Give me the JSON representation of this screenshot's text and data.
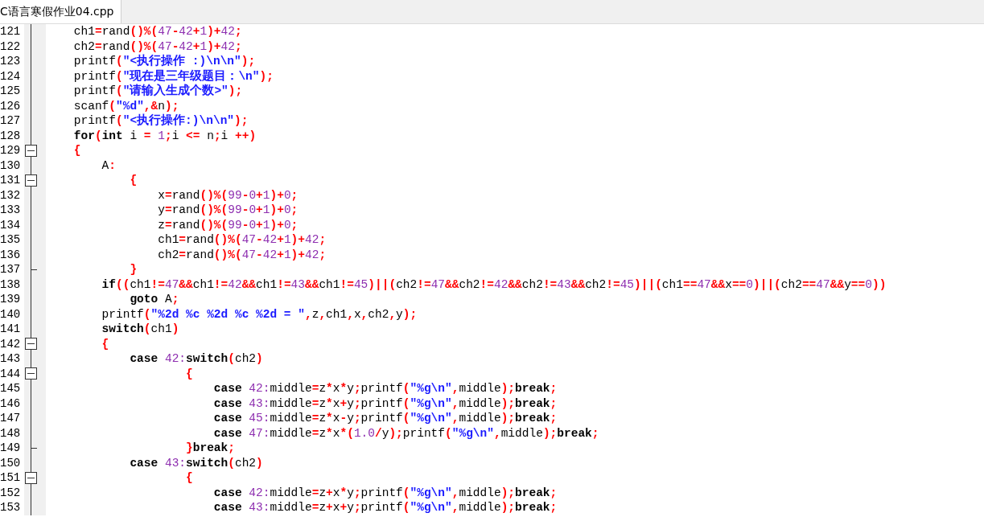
{
  "tabs": [
    {
      "label": "C语言寒假作业04.cpp",
      "selected": true
    }
  ],
  "editor": {
    "lines": [
      {
        "number": "121",
        "kind": "plain",
        "tokens": [
          {
            "kind": "plain",
            "text": "    ch1"
          },
          {
            "kind": "op",
            "text": "="
          },
          {
            "kind": "plain",
            "text": "rand"
          },
          {
            "kind": "op",
            "text": "()%("
          },
          {
            "kind": "num",
            "text": "47"
          },
          {
            "kind": "op",
            "text": "-"
          },
          {
            "kind": "num",
            "text": "42"
          },
          {
            "kind": "op",
            "text": "+"
          },
          {
            "kind": "num",
            "text": "1"
          },
          {
            "kind": "op",
            "text": ")+"
          },
          {
            "kind": "num",
            "text": "42"
          },
          {
            "kind": "op",
            "text": ";"
          }
        ]
      },
      {
        "number": "122",
        "kind": "plain",
        "tokens": [
          {
            "kind": "plain",
            "text": "    ch2"
          },
          {
            "kind": "op",
            "text": "="
          },
          {
            "kind": "plain",
            "text": "rand"
          },
          {
            "kind": "op",
            "text": "()%("
          },
          {
            "kind": "num",
            "text": "47"
          },
          {
            "kind": "op",
            "text": "-"
          },
          {
            "kind": "num",
            "text": "42"
          },
          {
            "kind": "op",
            "text": "+"
          },
          {
            "kind": "num",
            "text": "1"
          },
          {
            "kind": "op",
            "text": ")+"
          },
          {
            "kind": "num",
            "text": "42"
          },
          {
            "kind": "op",
            "text": ";"
          }
        ]
      },
      {
        "number": "123",
        "kind": "plain",
        "tokens": [
          {
            "kind": "plain",
            "text": "    printf"
          },
          {
            "kind": "op",
            "text": "("
          },
          {
            "kind": "str",
            "text": "\"<执行操作 :)\\n\\n\""
          },
          {
            "kind": "op",
            "text": ");"
          }
        ]
      },
      {
        "number": "124",
        "kind": "plain",
        "tokens": [
          {
            "kind": "plain",
            "text": "    printf"
          },
          {
            "kind": "op",
            "text": "("
          },
          {
            "kind": "str",
            "text": "\"现在是三年级题目：\\n\""
          },
          {
            "kind": "op",
            "text": ");"
          }
        ]
      },
      {
        "number": "125",
        "kind": "plain",
        "tokens": [
          {
            "kind": "plain",
            "text": "    printf"
          },
          {
            "kind": "op",
            "text": "("
          },
          {
            "kind": "str",
            "text": "\"请输入生成个数>\""
          },
          {
            "kind": "op",
            "text": ");"
          }
        ]
      },
      {
        "number": "126",
        "kind": "plain",
        "tokens": [
          {
            "kind": "plain",
            "text": "    scanf"
          },
          {
            "kind": "op",
            "text": "("
          },
          {
            "kind": "str",
            "text": "\"%d\""
          },
          {
            "kind": "op",
            "text": ",&"
          },
          {
            "kind": "plain",
            "text": "n"
          },
          {
            "kind": "op",
            "text": ");"
          }
        ]
      },
      {
        "number": "127",
        "kind": "plain",
        "tokens": [
          {
            "kind": "plain",
            "text": "    printf"
          },
          {
            "kind": "op",
            "text": "("
          },
          {
            "kind": "str",
            "text": "\"<执行操作:)\\n\\n\""
          },
          {
            "kind": "op",
            "text": ");"
          }
        ]
      },
      {
        "number": "128",
        "kind": "plain",
        "tokens": [
          {
            "kind": "kw",
            "text": "    for"
          },
          {
            "kind": "op",
            "text": "("
          },
          {
            "kind": "kw",
            "text": "int"
          },
          {
            "kind": "plain",
            "text": " i "
          },
          {
            "kind": "op",
            "text": "= "
          },
          {
            "kind": "num",
            "text": "1"
          },
          {
            "kind": "op",
            "text": ";"
          },
          {
            "kind": "plain",
            "text": "i "
          },
          {
            "kind": "op",
            "text": "<="
          },
          {
            "kind": "plain",
            "text": " n"
          },
          {
            "kind": "op",
            "text": ";"
          },
          {
            "kind": "plain",
            "text": "i "
          },
          {
            "kind": "op",
            "text": "++)"
          }
        ]
      },
      {
        "number": "129",
        "kind": "open",
        "tokens": [
          {
            "kind": "op",
            "text": "    {"
          }
        ]
      },
      {
        "number": "130",
        "kind": "plain",
        "tokens": [
          {
            "kind": "plain",
            "text": "        A"
          },
          {
            "kind": "op",
            "text": ":"
          }
        ]
      },
      {
        "number": "131",
        "kind": "open",
        "tokens": [
          {
            "kind": "op",
            "text": "            {"
          }
        ]
      },
      {
        "number": "132",
        "kind": "plain",
        "tokens": [
          {
            "kind": "plain",
            "text": "                x"
          },
          {
            "kind": "op",
            "text": "="
          },
          {
            "kind": "plain",
            "text": "rand"
          },
          {
            "kind": "op",
            "text": "()%("
          },
          {
            "kind": "num",
            "text": "99"
          },
          {
            "kind": "op",
            "text": "-"
          },
          {
            "kind": "num",
            "text": "0"
          },
          {
            "kind": "op",
            "text": "+"
          },
          {
            "kind": "num",
            "text": "1"
          },
          {
            "kind": "op",
            "text": ")+"
          },
          {
            "kind": "num",
            "text": "0"
          },
          {
            "kind": "op",
            "text": ";"
          }
        ]
      },
      {
        "number": "133",
        "kind": "plain",
        "tokens": [
          {
            "kind": "plain",
            "text": "                y"
          },
          {
            "kind": "op",
            "text": "="
          },
          {
            "kind": "plain",
            "text": "rand"
          },
          {
            "kind": "op",
            "text": "()%("
          },
          {
            "kind": "num",
            "text": "99"
          },
          {
            "kind": "op",
            "text": "-"
          },
          {
            "kind": "num",
            "text": "0"
          },
          {
            "kind": "op",
            "text": "+"
          },
          {
            "kind": "num",
            "text": "1"
          },
          {
            "kind": "op",
            "text": ")+"
          },
          {
            "kind": "num",
            "text": "0"
          },
          {
            "kind": "op",
            "text": ";"
          }
        ]
      },
      {
        "number": "134",
        "kind": "plain",
        "tokens": [
          {
            "kind": "plain",
            "text": "                z"
          },
          {
            "kind": "op",
            "text": "="
          },
          {
            "kind": "plain",
            "text": "rand"
          },
          {
            "kind": "op",
            "text": "()%("
          },
          {
            "kind": "num",
            "text": "99"
          },
          {
            "kind": "op",
            "text": "-"
          },
          {
            "kind": "num",
            "text": "0"
          },
          {
            "kind": "op",
            "text": "+"
          },
          {
            "kind": "num",
            "text": "1"
          },
          {
            "kind": "op",
            "text": ")+"
          },
          {
            "kind": "num",
            "text": "0"
          },
          {
            "kind": "op",
            "text": ";"
          }
        ]
      },
      {
        "number": "135",
        "kind": "plain",
        "tokens": [
          {
            "kind": "plain",
            "text": "                ch1"
          },
          {
            "kind": "op",
            "text": "="
          },
          {
            "kind": "plain",
            "text": "rand"
          },
          {
            "kind": "op",
            "text": "()%("
          },
          {
            "kind": "num",
            "text": "47"
          },
          {
            "kind": "op",
            "text": "-"
          },
          {
            "kind": "num",
            "text": "42"
          },
          {
            "kind": "op",
            "text": "+"
          },
          {
            "kind": "num",
            "text": "1"
          },
          {
            "kind": "op",
            "text": ")+"
          },
          {
            "kind": "num",
            "text": "42"
          },
          {
            "kind": "op",
            "text": ";"
          }
        ]
      },
      {
        "number": "136",
        "kind": "plain",
        "tokens": [
          {
            "kind": "plain",
            "text": "                ch2"
          },
          {
            "kind": "op",
            "text": "="
          },
          {
            "kind": "plain",
            "text": "rand"
          },
          {
            "kind": "op",
            "text": "()%("
          },
          {
            "kind": "num",
            "text": "47"
          },
          {
            "kind": "op",
            "text": "-"
          },
          {
            "kind": "num",
            "text": "42"
          },
          {
            "kind": "op",
            "text": "+"
          },
          {
            "kind": "num",
            "text": "1"
          },
          {
            "kind": "op",
            "text": ")+"
          },
          {
            "kind": "num",
            "text": "42"
          },
          {
            "kind": "op",
            "text": ";"
          }
        ]
      },
      {
        "number": "137",
        "kind": "end",
        "tokens": [
          {
            "kind": "op",
            "text": "            }"
          }
        ]
      },
      {
        "number": "138",
        "kind": "plain",
        "tokens": [
          {
            "kind": "kw",
            "text": "        if"
          },
          {
            "kind": "op",
            "text": "(("
          },
          {
            "kind": "plain",
            "text": "ch1"
          },
          {
            "kind": "op",
            "text": "!="
          },
          {
            "kind": "num",
            "text": "47"
          },
          {
            "kind": "op",
            "text": "&&"
          },
          {
            "kind": "plain",
            "text": "ch1"
          },
          {
            "kind": "op",
            "text": "!="
          },
          {
            "kind": "num",
            "text": "42"
          },
          {
            "kind": "op",
            "text": "&&"
          },
          {
            "kind": "plain",
            "text": "ch1"
          },
          {
            "kind": "op",
            "text": "!="
          },
          {
            "kind": "num",
            "text": "43"
          },
          {
            "kind": "op",
            "text": "&&"
          },
          {
            "kind": "plain",
            "text": "ch1"
          },
          {
            "kind": "op",
            "text": "!="
          },
          {
            "kind": "num",
            "text": "45"
          },
          {
            "kind": "op",
            "text": ")||("
          },
          {
            "kind": "plain",
            "text": "ch2"
          },
          {
            "kind": "op",
            "text": "!="
          },
          {
            "kind": "num",
            "text": "47"
          },
          {
            "kind": "op",
            "text": "&&"
          },
          {
            "kind": "plain",
            "text": "ch2"
          },
          {
            "kind": "op",
            "text": "!="
          },
          {
            "kind": "num",
            "text": "42"
          },
          {
            "kind": "op",
            "text": "&&"
          },
          {
            "kind": "plain",
            "text": "ch2"
          },
          {
            "kind": "op",
            "text": "!="
          },
          {
            "kind": "num",
            "text": "43"
          },
          {
            "kind": "op",
            "text": "&&"
          },
          {
            "kind": "plain",
            "text": "ch2"
          },
          {
            "kind": "op",
            "text": "!="
          },
          {
            "kind": "num",
            "text": "45"
          },
          {
            "kind": "op",
            "text": ")||("
          },
          {
            "kind": "plain",
            "text": "ch1"
          },
          {
            "kind": "op",
            "text": "=="
          },
          {
            "kind": "num",
            "text": "47"
          },
          {
            "kind": "op",
            "text": "&&"
          },
          {
            "kind": "plain",
            "text": "x"
          },
          {
            "kind": "op",
            "text": "=="
          },
          {
            "kind": "num",
            "text": "0"
          },
          {
            "kind": "op",
            "text": ")||("
          },
          {
            "kind": "plain",
            "text": "ch2"
          },
          {
            "kind": "op",
            "text": "=="
          },
          {
            "kind": "num",
            "text": "47"
          },
          {
            "kind": "op",
            "text": "&&"
          },
          {
            "kind": "plain",
            "text": "y"
          },
          {
            "kind": "op",
            "text": "=="
          },
          {
            "kind": "num",
            "text": "0"
          },
          {
            "kind": "op",
            "text": "))"
          }
        ]
      },
      {
        "number": "139",
        "kind": "plain",
        "tokens": [
          {
            "kind": "kw",
            "text": "            goto"
          },
          {
            "kind": "plain",
            "text": " A"
          },
          {
            "kind": "op",
            "text": ";"
          }
        ]
      },
      {
        "number": "140",
        "kind": "plain",
        "tokens": [
          {
            "kind": "plain",
            "text": "        printf"
          },
          {
            "kind": "op",
            "text": "("
          },
          {
            "kind": "str",
            "text": "\"%2d %c %2d %c %2d = \""
          },
          {
            "kind": "op",
            "text": ","
          },
          {
            "kind": "plain",
            "text": "z"
          },
          {
            "kind": "op",
            "text": ","
          },
          {
            "kind": "plain",
            "text": "ch1"
          },
          {
            "kind": "op",
            "text": ","
          },
          {
            "kind": "plain",
            "text": "x"
          },
          {
            "kind": "op",
            "text": ","
          },
          {
            "kind": "plain",
            "text": "ch2"
          },
          {
            "kind": "op",
            "text": ","
          },
          {
            "kind": "plain",
            "text": "y"
          },
          {
            "kind": "op",
            "text": ");"
          }
        ]
      },
      {
        "number": "141",
        "kind": "plain",
        "tokens": [
          {
            "kind": "kw",
            "text": "        switch"
          },
          {
            "kind": "op",
            "text": "("
          },
          {
            "kind": "plain",
            "text": "ch1"
          },
          {
            "kind": "op",
            "text": ")"
          }
        ]
      },
      {
        "number": "142",
        "kind": "open",
        "tokens": [
          {
            "kind": "op",
            "text": "        {"
          }
        ]
      },
      {
        "number": "143",
        "kind": "plain",
        "tokens": [
          {
            "kind": "kw",
            "text": "            case "
          },
          {
            "kind": "num",
            "text": "42:"
          },
          {
            "kind": "kw",
            "text": "switch"
          },
          {
            "kind": "op",
            "text": "("
          },
          {
            "kind": "plain",
            "text": "ch2"
          },
          {
            "kind": "op",
            "text": ")"
          }
        ]
      },
      {
        "number": "144",
        "kind": "open",
        "tokens": [
          {
            "kind": "op",
            "text": "                    {"
          }
        ]
      },
      {
        "number": "145",
        "kind": "plain",
        "tokens": [
          {
            "kind": "kw",
            "text": "                        case "
          },
          {
            "kind": "num",
            "text": "42:"
          },
          {
            "kind": "plain",
            "text": "middle"
          },
          {
            "kind": "op",
            "text": "="
          },
          {
            "kind": "plain",
            "text": "z"
          },
          {
            "kind": "op",
            "text": "*"
          },
          {
            "kind": "plain",
            "text": "x"
          },
          {
            "kind": "op",
            "text": "*"
          },
          {
            "kind": "plain",
            "text": "y"
          },
          {
            "kind": "op",
            "text": ";"
          },
          {
            "kind": "plain",
            "text": "printf"
          },
          {
            "kind": "op",
            "text": "("
          },
          {
            "kind": "str",
            "text": "\"%g\\n\""
          },
          {
            "kind": "op",
            "text": ","
          },
          {
            "kind": "plain",
            "text": "middle"
          },
          {
            "kind": "op",
            "text": ");"
          },
          {
            "kind": "kw",
            "text": "break"
          },
          {
            "kind": "op",
            "text": ";"
          }
        ]
      },
      {
        "number": "146",
        "kind": "plain",
        "tokens": [
          {
            "kind": "kw",
            "text": "                        case "
          },
          {
            "kind": "num",
            "text": "43:"
          },
          {
            "kind": "plain",
            "text": "middle"
          },
          {
            "kind": "op",
            "text": "="
          },
          {
            "kind": "plain",
            "text": "z"
          },
          {
            "kind": "op",
            "text": "*"
          },
          {
            "kind": "plain",
            "text": "x"
          },
          {
            "kind": "op",
            "text": "+"
          },
          {
            "kind": "plain",
            "text": "y"
          },
          {
            "kind": "op",
            "text": ";"
          },
          {
            "kind": "plain",
            "text": "printf"
          },
          {
            "kind": "op",
            "text": "("
          },
          {
            "kind": "str",
            "text": "\"%g\\n\""
          },
          {
            "kind": "op",
            "text": ","
          },
          {
            "kind": "plain",
            "text": "middle"
          },
          {
            "kind": "op",
            "text": ");"
          },
          {
            "kind": "kw",
            "text": "break"
          },
          {
            "kind": "op",
            "text": ";"
          }
        ]
      },
      {
        "number": "147",
        "kind": "plain",
        "tokens": [
          {
            "kind": "kw",
            "text": "                        case "
          },
          {
            "kind": "num",
            "text": "45:"
          },
          {
            "kind": "plain",
            "text": "middle"
          },
          {
            "kind": "op",
            "text": "="
          },
          {
            "kind": "plain",
            "text": "z"
          },
          {
            "kind": "op",
            "text": "*"
          },
          {
            "kind": "plain",
            "text": "x"
          },
          {
            "kind": "op",
            "text": "-"
          },
          {
            "kind": "plain",
            "text": "y"
          },
          {
            "kind": "op",
            "text": ";"
          },
          {
            "kind": "plain",
            "text": "printf"
          },
          {
            "kind": "op",
            "text": "("
          },
          {
            "kind": "str",
            "text": "\"%g\\n\""
          },
          {
            "kind": "op",
            "text": ","
          },
          {
            "kind": "plain",
            "text": "middle"
          },
          {
            "kind": "op",
            "text": ");"
          },
          {
            "kind": "kw",
            "text": "break"
          },
          {
            "kind": "op",
            "text": ";"
          }
        ]
      },
      {
        "number": "148",
        "kind": "plain",
        "tokens": [
          {
            "kind": "kw",
            "text": "                        case "
          },
          {
            "kind": "num",
            "text": "47:"
          },
          {
            "kind": "plain",
            "text": "middle"
          },
          {
            "kind": "op",
            "text": "="
          },
          {
            "kind": "plain",
            "text": "z"
          },
          {
            "kind": "op",
            "text": "*"
          },
          {
            "kind": "plain",
            "text": "x"
          },
          {
            "kind": "op",
            "text": "*("
          },
          {
            "kind": "num",
            "text": "1.0"
          },
          {
            "kind": "op",
            "text": "/"
          },
          {
            "kind": "plain",
            "text": "y"
          },
          {
            "kind": "op",
            "text": ");"
          },
          {
            "kind": "plain",
            "text": "printf"
          },
          {
            "kind": "op",
            "text": "("
          },
          {
            "kind": "str",
            "text": "\"%g\\n\""
          },
          {
            "kind": "op",
            "text": ","
          },
          {
            "kind": "plain",
            "text": "middle"
          },
          {
            "kind": "op",
            "text": ");"
          },
          {
            "kind": "kw",
            "text": "break"
          },
          {
            "kind": "op",
            "text": ";"
          }
        ]
      },
      {
        "number": "149",
        "kind": "end",
        "tokens": [
          {
            "kind": "op",
            "text": "                    }"
          },
          {
            "kind": "kw",
            "text": "break"
          },
          {
            "kind": "op",
            "text": ";"
          }
        ]
      },
      {
        "number": "150",
        "kind": "plain",
        "tokens": [
          {
            "kind": "kw",
            "text": "            case "
          },
          {
            "kind": "num",
            "text": "43:"
          },
          {
            "kind": "kw",
            "text": "switch"
          },
          {
            "kind": "op",
            "text": "("
          },
          {
            "kind": "plain",
            "text": "ch2"
          },
          {
            "kind": "op",
            "text": ")"
          }
        ]
      },
      {
        "number": "151",
        "kind": "open",
        "tokens": [
          {
            "kind": "op",
            "text": "                    {"
          }
        ]
      },
      {
        "number": "152",
        "kind": "plain",
        "tokens": [
          {
            "kind": "kw",
            "text": "                        case "
          },
          {
            "kind": "num",
            "text": "42:"
          },
          {
            "kind": "plain",
            "text": "middle"
          },
          {
            "kind": "op",
            "text": "="
          },
          {
            "kind": "plain",
            "text": "z"
          },
          {
            "kind": "op",
            "text": "+"
          },
          {
            "kind": "plain",
            "text": "x"
          },
          {
            "kind": "op",
            "text": "*"
          },
          {
            "kind": "plain",
            "text": "y"
          },
          {
            "kind": "op",
            "text": ";"
          },
          {
            "kind": "plain",
            "text": "printf"
          },
          {
            "kind": "op",
            "text": "("
          },
          {
            "kind": "str",
            "text": "\"%g\\n\""
          },
          {
            "kind": "op",
            "text": ","
          },
          {
            "kind": "plain",
            "text": "middle"
          },
          {
            "kind": "op",
            "text": ");"
          },
          {
            "kind": "kw",
            "text": "break"
          },
          {
            "kind": "op",
            "text": ";"
          }
        ]
      },
      {
        "number": "153",
        "kind": "plain",
        "tokens": [
          {
            "kind": "kw",
            "text": "                        case "
          },
          {
            "kind": "num",
            "text": "43:"
          },
          {
            "kind": "plain",
            "text": "middle"
          },
          {
            "kind": "op",
            "text": "="
          },
          {
            "kind": "plain",
            "text": "z"
          },
          {
            "kind": "op",
            "text": "+"
          },
          {
            "kind": "plain",
            "text": "x"
          },
          {
            "kind": "op",
            "text": "+"
          },
          {
            "kind": "plain",
            "text": "y"
          },
          {
            "kind": "op",
            "text": ";"
          },
          {
            "kind": "plain",
            "text": "printf"
          },
          {
            "kind": "op",
            "text": "("
          },
          {
            "kind": "str",
            "text": "\"%g\\n\""
          },
          {
            "kind": "op",
            "text": ","
          },
          {
            "kind": "plain",
            "text": "middle"
          },
          {
            "kind": "op",
            "text": ");"
          },
          {
            "kind": "kw",
            "text": "break"
          },
          {
            "kind": "op",
            "text": ";"
          }
        ]
      }
    ]
  }
}
